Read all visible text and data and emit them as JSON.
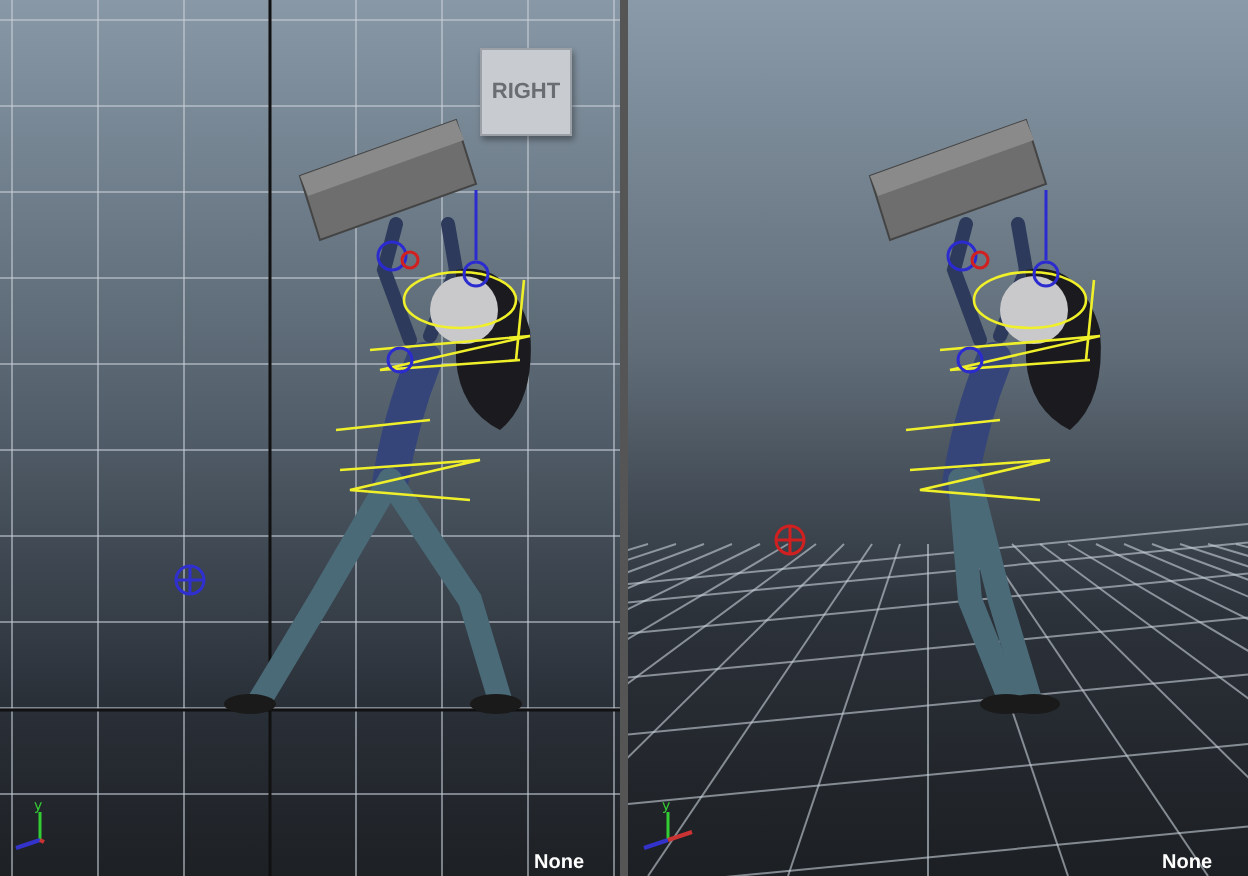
{
  "viewports": [
    {
      "kind": "ortho",
      "view_cube": {
        "label": "RIGHT"
      },
      "axis_label": "y",
      "status": "None"
    },
    {
      "kind": "perspective",
      "axis_label": "y",
      "status": "None"
    }
  ]
}
